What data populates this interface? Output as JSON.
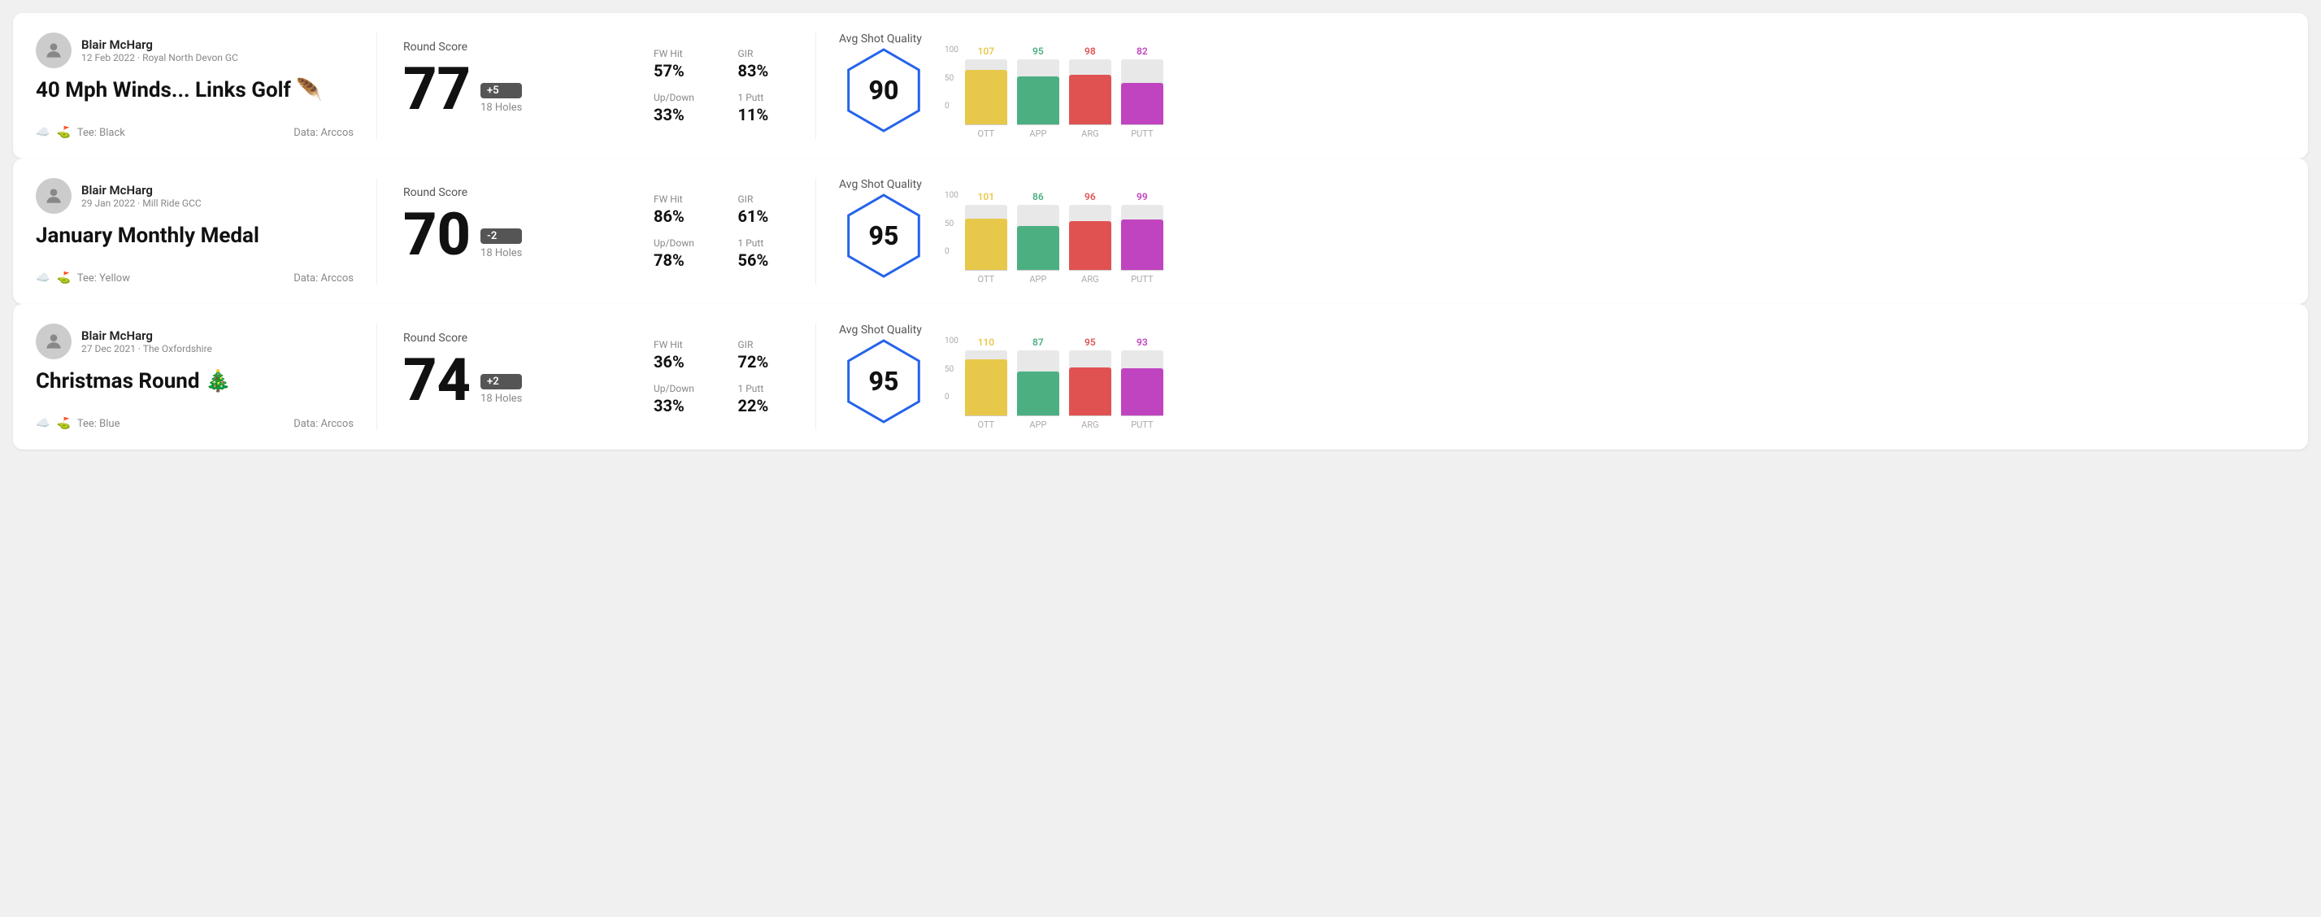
{
  "rounds": [
    {
      "id": "round-1",
      "user": {
        "name": "Blair McHarg",
        "meta": "12 Feb 2022 · Royal North Devon GC"
      },
      "title": "40 Mph Winds... Links Golf 🪶",
      "tee": "Black",
      "data_source": "Data: Arccos",
      "round_score": {
        "label": "Round Score",
        "score": "77",
        "badge": "+5",
        "holes": "18 Holes"
      },
      "stats": {
        "fw_hit_label": "FW Hit",
        "fw_hit_value": "57%",
        "gir_label": "GIR",
        "gir_value": "83%",
        "updown_label": "Up/Down",
        "updown_value": "33%",
        "oneputt_label": "1 Putt",
        "oneputt_value": "11%"
      },
      "quality": {
        "label": "Avg Shot Quality",
        "score": "90",
        "bars": [
          {
            "label": "OTT",
            "value": 107,
            "color": "#e8c84a",
            "max": 120
          },
          {
            "label": "APP",
            "value": 95,
            "color": "#4caf82",
            "max": 120
          },
          {
            "label": "ARG",
            "value": 98,
            "color": "#e05252",
            "max": 120
          },
          {
            "label": "PUTT",
            "value": 82,
            "color": "#c044c0",
            "max": 120
          }
        ]
      }
    },
    {
      "id": "round-2",
      "user": {
        "name": "Blair McHarg",
        "meta": "29 Jan 2022 · Mill Ride GCC"
      },
      "title": "January Monthly Medal",
      "tee": "Yellow",
      "data_source": "Data: Arccos",
      "round_score": {
        "label": "Round Score",
        "score": "70",
        "badge": "-2",
        "holes": "18 Holes"
      },
      "stats": {
        "fw_hit_label": "FW Hit",
        "fw_hit_value": "86%",
        "gir_label": "GIR",
        "gir_value": "61%",
        "updown_label": "Up/Down",
        "updown_value": "78%",
        "oneputt_label": "1 Putt",
        "oneputt_value": "56%"
      },
      "quality": {
        "label": "Avg Shot Quality",
        "score": "95",
        "bars": [
          {
            "label": "OTT",
            "value": 101,
            "color": "#e8c84a",
            "max": 120
          },
          {
            "label": "APP",
            "value": 86,
            "color": "#4caf82",
            "max": 120
          },
          {
            "label": "ARG",
            "value": 96,
            "color": "#e05252",
            "max": 120
          },
          {
            "label": "PUTT",
            "value": 99,
            "color": "#c044c0",
            "max": 120
          }
        ]
      }
    },
    {
      "id": "round-3",
      "user": {
        "name": "Blair McHarg",
        "meta": "27 Dec 2021 · The Oxfordshire"
      },
      "title": "Christmas Round 🎄",
      "tee": "Blue",
      "data_source": "Data: Arccos",
      "round_score": {
        "label": "Round Score",
        "score": "74",
        "badge": "+2",
        "holes": "18 Holes"
      },
      "stats": {
        "fw_hit_label": "FW Hit",
        "fw_hit_value": "36%",
        "gir_label": "GIR",
        "gir_value": "72%",
        "updown_label": "Up/Down",
        "updown_value": "33%",
        "oneputt_label": "1 Putt",
        "oneputt_value": "22%"
      },
      "quality": {
        "label": "Avg Shot Quality",
        "score": "95",
        "bars": [
          {
            "label": "OTT",
            "value": 110,
            "color": "#e8c84a",
            "max": 120
          },
          {
            "label": "APP",
            "value": 87,
            "color": "#4caf82",
            "max": 120
          },
          {
            "label": "ARG",
            "value": 95,
            "color": "#e05252",
            "max": 120
          },
          {
            "label": "PUTT",
            "value": 93,
            "color": "#c044c0",
            "max": 120
          }
        ]
      }
    }
  ],
  "y_axis_labels": [
    "100",
    "50",
    "0"
  ]
}
